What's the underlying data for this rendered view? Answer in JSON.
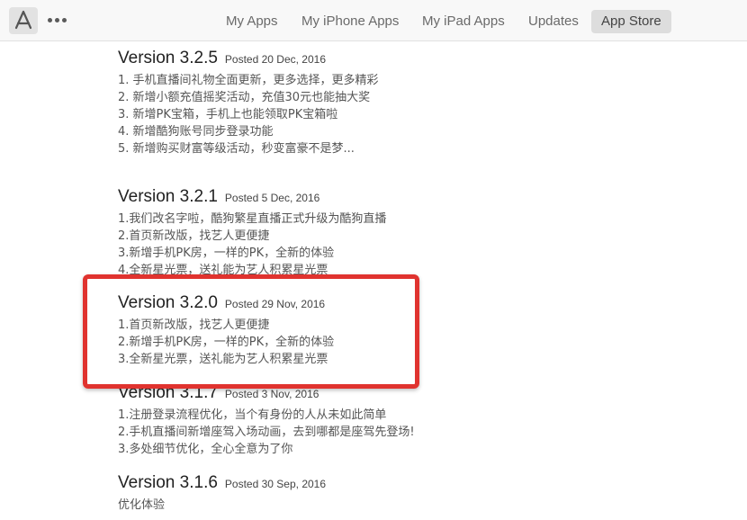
{
  "toolbar": {
    "app_icon": "app-store-icon",
    "more_icon": "more-dots-icon",
    "tabs": [
      {
        "label": "My Apps"
      },
      {
        "label": "My iPhone Apps"
      },
      {
        "label": "My iPad Apps"
      },
      {
        "label": "Updates"
      },
      {
        "label": "App Store",
        "active": true
      }
    ]
  },
  "releases": [
    {
      "version": "Version 3.2.5",
      "posted": "Posted 20 Dec, 2016",
      "notes": [
        "1. 手机直播间礼物全面更新，更多选择，更多精彩",
        "2. 新增小额充值摇奖活动，充值30元也能抽大奖",
        "3. 新增PK宝箱，手机上也能领取PK宝箱啦",
        "4. 新增酷狗账号同步登录功能",
        "5. 新增购买财富等级活动，秒变富豪不是梦..."
      ]
    },
    {
      "version": "Version 3.2.1",
      "posted": "Posted 5 Dec, 2016",
      "notes": [
        "1.我们改名字啦，酷狗繁星直播正式升级为酷狗直播",
        "2.首页新改版，找艺人更便捷",
        "3.新增手机PK房，一样的PK，全新的体验",
        "4.全新星光票，送礼能为艺人积累星光票"
      ]
    },
    {
      "version": "Version 3.2.0",
      "posted": "Posted 29 Nov, 2016",
      "notes": [
        "1.首页新改版，找艺人更便捷",
        "2.新增手机PK房，一样的PK，全新的体验",
        "3.全新星光票，送礼能为艺人积累星光票"
      ]
    },
    {
      "version": "Version 3.1.7",
      "posted": "Posted 3 Nov, 2016",
      "notes": [
        "1.注册登录流程优化，当个有身份的人从未如此简单",
        "2.手机直播间新增座驾入场动画，去到哪都是座驾先登场!",
        "3.多处细节优化，全心全意为了你"
      ]
    },
    {
      "version": "Version 3.1.6",
      "posted": "Posted 30 Sep, 2016",
      "notes": [
        "优化体验"
      ]
    }
  ],
  "highlight_color": "#e0332f"
}
